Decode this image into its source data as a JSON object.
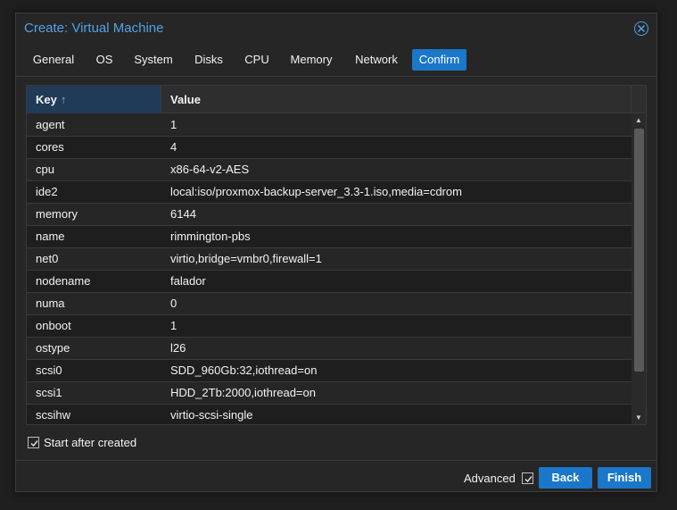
{
  "window": {
    "title": "Create: Virtual Machine",
    "close_icon": "close-circle-icon"
  },
  "tabs": [
    {
      "label": "General",
      "active": false
    },
    {
      "label": "OS",
      "active": false
    },
    {
      "label": "System",
      "active": false
    },
    {
      "label": "Disks",
      "active": false
    },
    {
      "label": "CPU",
      "active": false
    },
    {
      "label": "Memory",
      "active": false
    },
    {
      "label": "Network",
      "active": false
    },
    {
      "label": "Confirm",
      "active": true
    }
  ],
  "grid": {
    "columns": {
      "key": "Key",
      "value": "Value",
      "sort_indicator": "↑"
    },
    "rows": [
      {
        "key": "agent",
        "value": "1"
      },
      {
        "key": "cores",
        "value": "4"
      },
      {
        "key": "cpu",
        "value": "x86-64-v2-AES"
      },
      {
        "key": "ide2",
        "value": "local:iso/proxmox-backup-server_3.3-1.iso,media=cdrom"
      },
      {
        "key": "memory",
        "value": "6144"
      },
      {
        "key": "name",
        "value": "rimmington-pbs"
      },
      {
        "key": "net0",
        "value": "virtio,bridge=vmbr0,firewall=1"
      },
      {
        "key": "nodename",
        "value": "falador"
      },
      {
        "key": "numa",
        "value": "0"
      },
      {
        "key": "onboot",
        "value": "1"
      },
      {
        "key": "ostype",
        "value": "l26"
      },
      {
        "key": "scsi0",
        "value": "SDD_960Gb:32,iothread=on"
      },
      {
        "key": "scsi1",
        "value": "HDD_2Tb:2000,iothread=on"
      },
      {
        "key": "scsihw",
        "value": "virtio-scsi-single"
      }
    ]
  },
  "options": {
    "start_after_created": {
      "label": "Start after created",
      "checked": true
    }
  },
  "footer": {
    "advanced": {
      "label": "Advanced",
      "checked": true
    },
    "back_label": "Back",
    "finish_label": "Finish"
  },
  "colors": {
    "accent": "#1a77c9",
    "title": "#4fa3e6"
  }
}
